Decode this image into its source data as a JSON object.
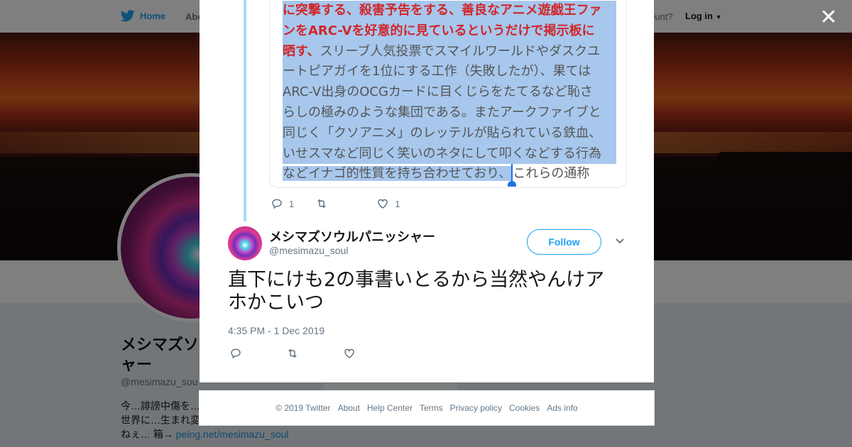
{
  "background": {
    "nav": {
      "home": "Home",
      "about": "Abo",
      "account_prompt": "ccount?",
      "login": "Log in"
    },
    "profile": {
      "name_line1": "メシマズソ",
      "name_line2": "ャー",
      "handle": "@mesimazu_sou",
      "bio_line1": "今…誹謗中傷を…",
      "bio_line2": "世界に…生まれ変",
      "bio_line3": "ねぇ… 箱→ ",
      "bio_link": "peing.net/mesimazu_soul"
    }
  },
  "modal": {
    "close_icon": "close-icon",
    "quoted": {
      "lines": [
        {
          "red": "に突撃する、殺害予告をする、善良なアニメ遊戯王ファ",
          "plain": ""
        },
        {
          "red": "ンをARC-Vを好意的に見ているというだけで掲示板に",
          "plain": ""
        },
        {
          "red": "晒す、",
          "plain": "スリーブ人気投票でスマイルワールドやダスクユ"
        },
        {
          "red": "",
          "plain": "ートピアガイを1位にする工作（失敗したが）、果ては"
        },
        {
          "red": "",
          "plain": "ARC-V出身のOCGカードに目くじらをたてるなど恥さ"
        },
        {
          "red": "",
          "plain": "らしの極みのような集団である。またアークファイブと"
        },
        {
          "red": "",
          "plain": "同じく「クソアニメ」のレッテルが貼られている鉄血、"
        },
        {
          "red": "",
          "plain": "いせスマなど同じく笑いのネタにして叩くなどする行為"
        }
      ],
      "last_line_selected": "などイナゴ的性質を持ち合わせており、",
      "last_line_rest": "これらの通称"
    },
    "parent_actions": {
      "reply_count": "1",
      "retweet_count": "",
      "like_count": "1"
    },
    "tweet": {
      "author_name": "メシマズソウルパニッシャー",
      "author_handle": "@mesimazu_soul",
      "follow_label": "Follow",
      "text_line1": "直下にけも2の事書いとるから当然やんけア",
      "text_line2": "ホかこいつ",
      "timestamp": "4:35 PM - 1 Dec 2019"
    }
  },
  "footer": {
    "copyright": "© 2019 Twitter",
    "about": "About",
    "help": "Help Center",
    "terms": "Terms",
    "privacy": "Privacy policy",
    "cookies": "Cookies",
    "ads": "Ads info"
  },
  "colors": {
    "accent": "#1da1f2",
    "highlight_red": "#d0272c",
    "selection": "#a7c7ec",
    "thread_line": "#a9dcf6"
  }
}
